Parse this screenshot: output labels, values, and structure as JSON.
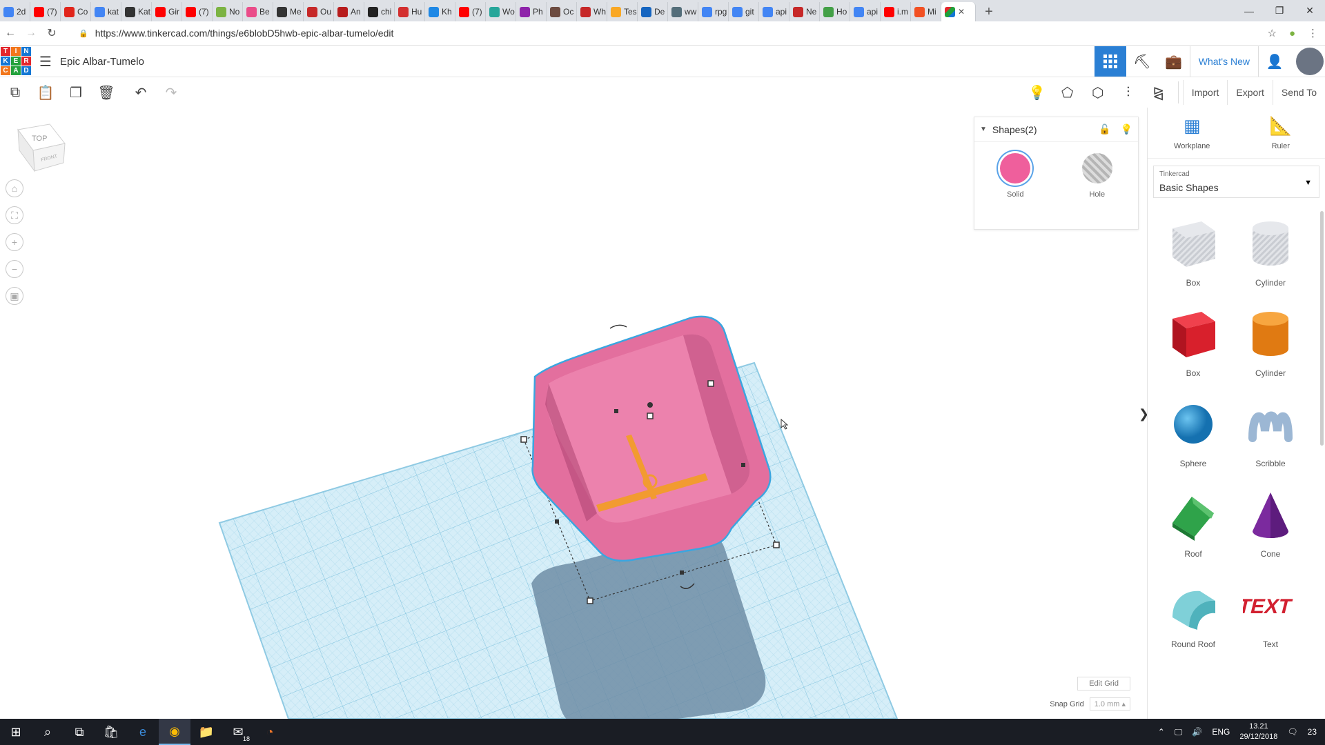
{
  "browser": {
    "tabs": [
      {
        "label": "2d",
        "icon": "google-icon",
        "color": "#4285f4"
      },
      {
        "label": "(7)",
        "icon": "youtube-icon",
        "color": "#ff0000"
      },
      {
        "label": "Co",
        "icon": "adobe-icon",
        "color": "#e1251b"
      },
      {
        "label": "kat",
        "icon": "google-icon",
        "color": "#4285f4"
      },
      {
        "label": "Kat",
        "icon": "wikipedia-icon",
        "color": "#333333"
      },
      {
        "label": "Gir",
        "icon": "youtube-icon",
        "color": "#ff0000"
      },
      {
        "label": "(7)",
        "icon": "youtube-icon",
        "color": "#ff0000"
      },
      {
        "label": "No",
        "icon": "doc-icon",
        "color": "#7cb342"
      },
      {
        "label": "Be",
        "icon": "dribbble-icon",
        "color": "#ea4c89"
      },
      {
        "label": "Me",
        "icon": "wikipedia-icon",
        "color": "#333333"
      },
      {
        "label": "Ou",
        "icon": "site-icon",
        "color": "#c62828"
      },
      {
        "label": "An",
        "icon": "site-icon",
        "color": "#b71c1c"
      },
      {
        "label": "chi",
        "icon": "site-icon",
        "color": "#222222"
      },
      {
        "label": "Hu",
        "icon": "site-icon",
        "color": "#d32f2f"
      },
      {
        "label": "Kh",
        "icon": "site-icon",
        "color": "#1e88e5"
      },
      {
        "label": "(7)",
        "icon": "youtube-icon",
        "color": "#ff0000"
      },
      {
        "label": "Wo",
        "icon": "site-icon",
        "color": "#26a69a"
      },
      {
        "label": "Ph",
        "icon": "site-icon",
        "color": "#8e24aa"
      },
      {
        "label": "Oc",
        "icon": "site-icon",
        "color": "#6d4c41"
      },
      {
        "label": "Wh",
        "icon": "site-icon",
        "color": "#c62828"
      },
      {
        "label": "Tes",
        "icon": "site-icon",
        "color": "#f9a825"
      },
      {
        "label": "De",
        "icon": "site-icon",
        "color": "#1565c0"
      },
      {
        "label": "ww",
        "icon": "site-icon",
        "color": "#546e7a"
      },
      {
        "label": "rpg",
        "icon": "google-icon",
        "color": "#4285f4"
      },
      {
        "label": "git",
        "icon": "google-icon",
        "color": "#4285f4"
      },
      {
        "label": "api",
        "icon": "google-icon",
        "color": "#4285f4"
      },
      {
        "label": "Ne",
        "icon": "site-icon",
        "color": "#c62828"
      },
      {
        "label": "Ho",
        "icon": "site-icon",
        "color": "#43a047"
      },
      {
        "label": "api",
        "icon": "google-icon",
        "color": "#4285f4"
      },
      {
        "label": "i.m",
        "icon": "youtube-icon",
        "color": "#ff0000"
      },
      {
        "label": "Mi",
        "icon": "microsoft-icon",
        "color": "#f25022"
      }
    ],
    "active_tab_icon": "tinkercad-icon",
    "url": "https://www.tinkercad.com/things/e6blobD5hwb-epic-albar-tumelo/edit"
  },
  "app": {
    "logo_letters": [
      "T",
      "I",
      "N",
      "K",
      "E",
      "R",
      "C",
      "A",
      "D"
    ],
    "logo_colors": [
      "#e3262c",
      "#f2761b",
      "#1477d4",
      "#1477d4",
      "#22a13b",
      "#e3262c",
      "#f2761b",
      "#22a13b",
      "#1477d4"
    ],
    "title": "Epic Albar-Tumelo",
    "whats_new": "What's New",
    "accent_color": "#2a7fd4"
  },
  "toolbar": {
    "import": "Import",
    "export": "Export",
    "send_to": "Send To"
  },
  "viewcube": {
    "top": "TOP",
    "front": "FRONT"
  },
  "inspector": {
    "title": "Shapes(2)",
    "solid_label": "Solid",
    "hole_label": "Hole",
    "solid_color": "#ef5f9c"
  },
  "grid": {
    "edit_grid": "Edit Grid",
    "snap_label": "Snap Grid",
    "snap_value": "1.0 mm ▴"
  },
  "panel": {
    "workplane": "Workplane",
    "ruler": "Ruler",
    "library_small": "Tinkercad",
    "library_name": "Basic Shapes",
    "shapes": [
      {
        "label": "Box",
        "kind": "box-hole"
      },
      {
        "label": "Cylinder",
        "kind": "cylinder-hole"
      },
      {
        "label": "Box",
        "kind": "box"
      },
      {
        "label": "Cylinder",
        "kind": "cylinder"
      },
      {
        "label": "Sphere",
        "kind": "sphere"
      },
      {
        "label": "Scribble",
        "kind": "scribble"
      },
      {
        "label": "Roof",
        "kind": "roof"
      },
      {
        "label": "Cone",
        "kind": "cone"
      },
      {
        "label": "Round Roof",
        "kind": "round-roof"
      },
      {
        "label": "Text",
        "kind": "text"
      }
    ]
  },
  "taskbar": {
    "lang": "ENG",
    "time": "13.21",
    "date": "29/12/2018",
    "notifications": "23",
    "mail_badge": "18"
  }
}
